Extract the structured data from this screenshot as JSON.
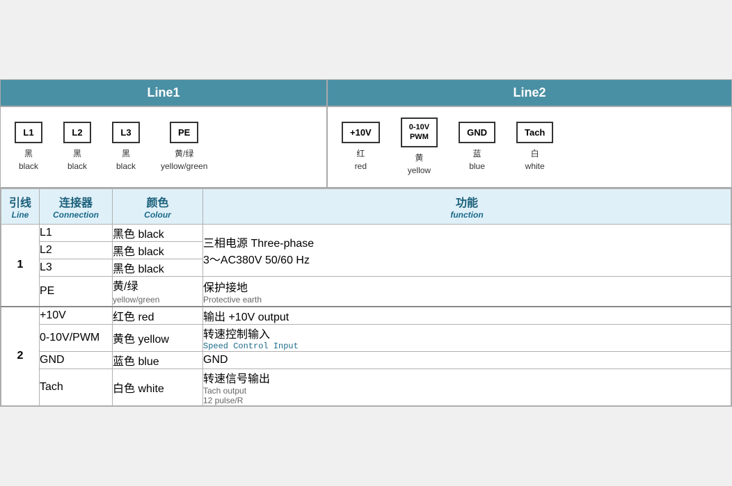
{
  "header": {
    "line1_label": "Line1",
    "line2_label": "Line2"
  },
  "line1_connectors": [
    {
      "id": "L1",
      "label_cn": "黑",
      "label_en": "black"
    },
    {
      "id": "L2",
      "label_cn": "黑",
      "label_en": "black"
    },
    {
      "id": "L3",
      "label_cn": "黑",
      "label_en": "black"
    },
    {
      "id": "PE",
      "label_cn": "黄/绿",
      "label_en": "yellow/green"
    }
  ],
  "line2_connectors": [
    {
      "id": "+10V",
      "label_cn": "红",
      "label_en": "red"
    },
    {
      "id": "0-10V\nPWM",
      "label_cn": "黄",
      "label_en": "yellow"
    },
    {
      "id": "GND",
      "label_cn": "蓝",
      "label_en": "blue"
    },
    {
      "id": "Tach",
      "label_cn": "白",
      "label_en": "white"
    }
  ],
  "table_headers": {
    "line_cn": "引线",
    "line_en": "Line",
    "conn_cn": "连接器",
    "conn_en": "Connection",
    "color_cn": "颜色",
    "color_en": "Colour",
    "func_cn": "功能",
    "func_en": "function"
  },
  "table_rows": [
    {
      "line_num": "1",
      "sub_rows": [
        {
          "conn": "L1",
          "color_cn": "黑色 black",
          "func_cn": "三相电源 Three-phase",
          "func_en": "3～AC380V 50/60 Hz",
          "rowspan": 3
        },
        {
          "conn": "L2",
          "color_cn": "黑色 black",
          "func_cn": "",
          "func_en": ""
        },
        {
          "conn": "L3",
          "color_cn": "黑色 black",
          "func_cn": "",
          "func_en": ""
        },
        {
          "conn": "PE",
          "color_cn": "黄/绿",
          "color_en": "yellow/green",
          "func_cn": "保护接地",
          "func_en": "Protective earth"
        }
      ]
    },
    {
      "line_num": "2",
      "sub_rows": [
        {
          "conn": "+10V",
          "color_cn": "红色 red",
          "func_cn": "输出 +10V output",
          "func_en": ""
        },
        {
          "conn": "0-10V/PWM",
          "color_cn": "黄色 yellow",
          "func_cn": "转速控制输入",
          "func_en": "Speed Control Input",
          "func_mono": true
        },
        {
          "conn": "GND",
          "color_cn": "蓝色 blue",
          "func_cn": "GND",
          "func_en": ""
        },
        {
          "conn": "Tach",
          "color_cn": "白色 white",
          "func_cn": "转速信号输出",
          "func_en": "Tach output\n12 pulse/R"
        }
      ]
    }
  ]
}
